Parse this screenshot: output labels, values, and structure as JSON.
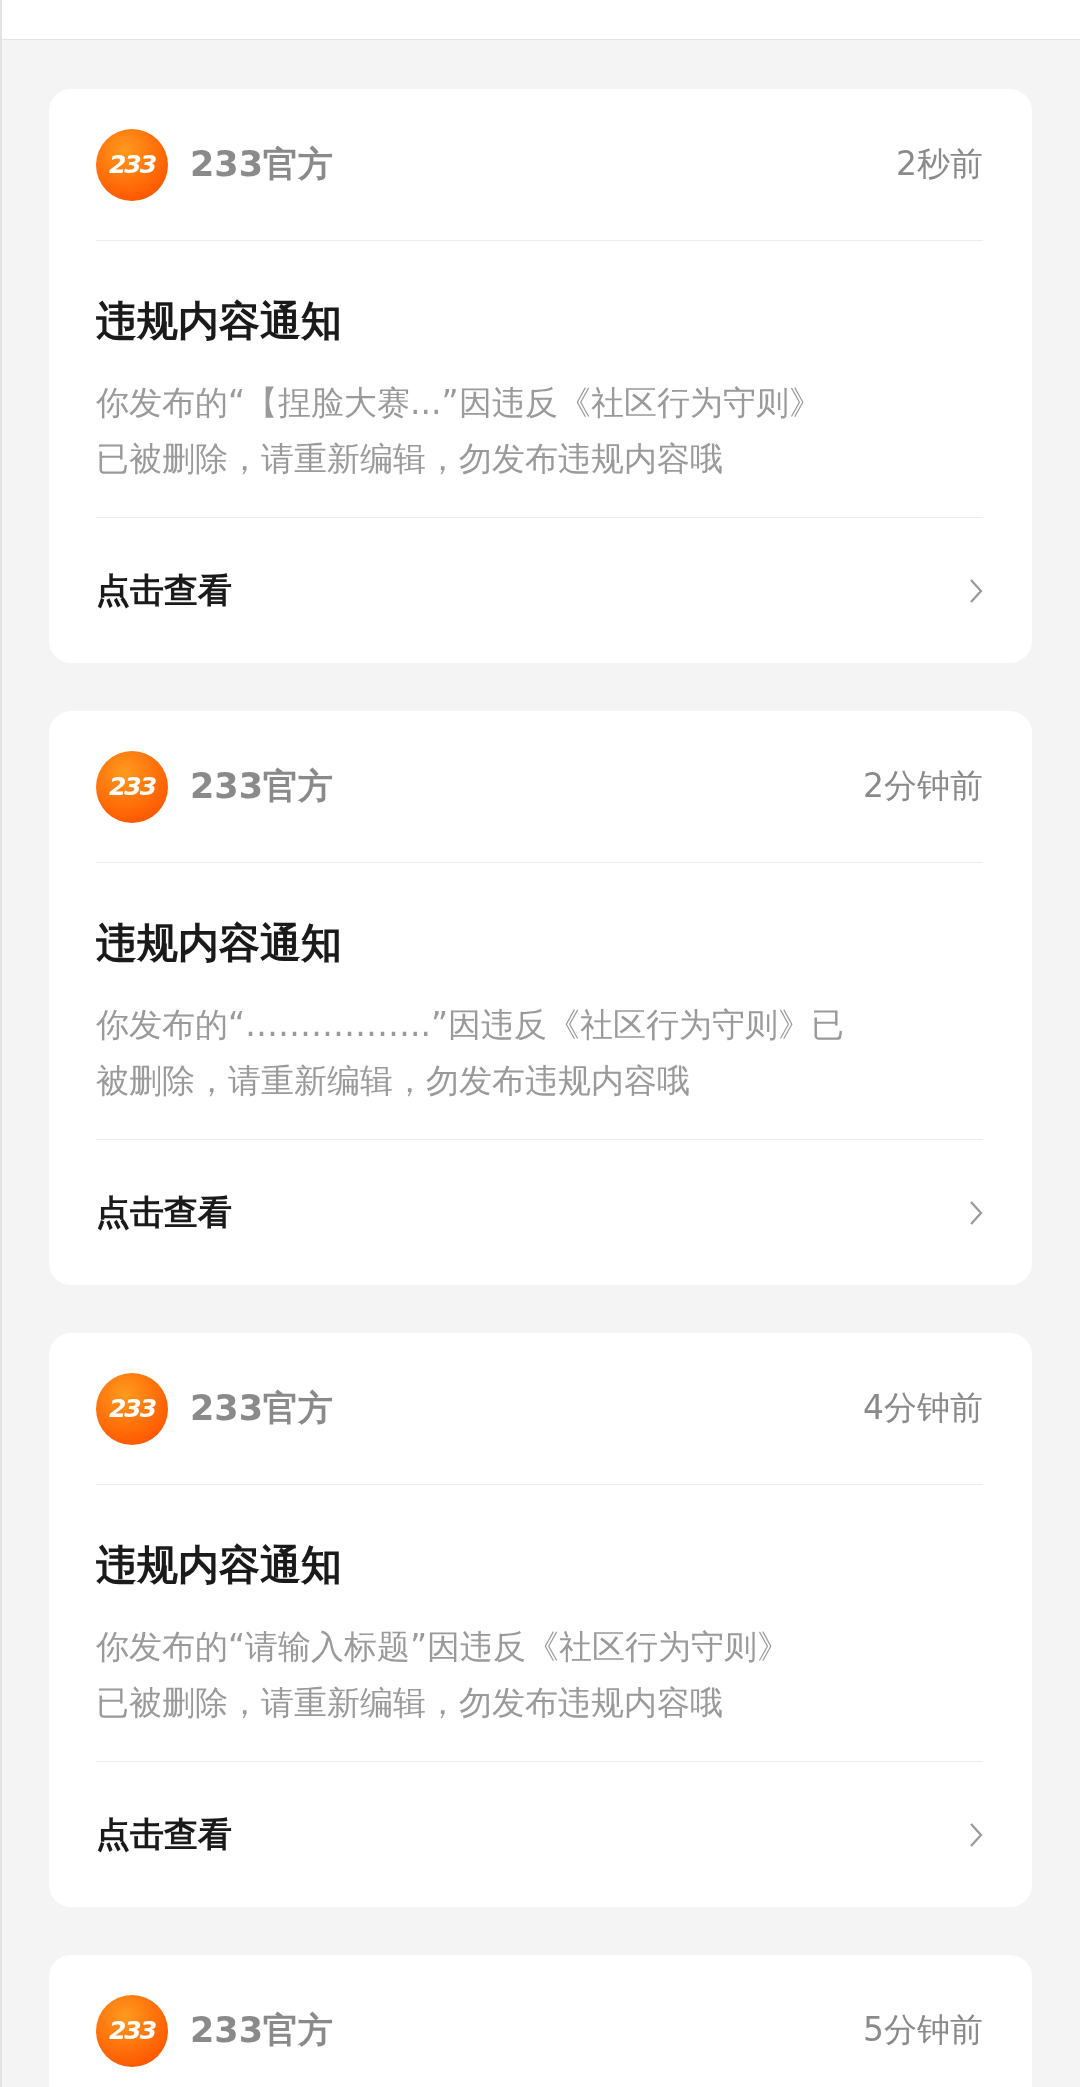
{
  "notifications": [
    {
      "logo_text": "233",
      "sender": "233官方",
      "time": "2秒前",
      "title": "违规内容通知",
      "body_lines": [
        "你发布的“【捏脸大赛...”因违反《社区行为守则》",
        "已被删除，请重新编辑，勿发布违规内容哦"
      ],
      "action": "点击查看"
    },
    {
      "logo_text": "233",
      "sender": "233官方",
      "time": "2分钟前",
      "title": "违规内容通知",
      "body_lines": [
        "你发布的“……………..”因违反《社区行为守则》已",
        "被删除，请重新编辑，勿发布违规内容哦"
      ],
      "action": "点击查看"
    },
    {
      "logo_text": "233",
      "sender": "233官方",
      "time": "4分钟前",
      "title": "违规内容通知",
      "body_lines": [
        "你发布的“请输入标题”因违反《社区行为守则》",
        "已被删除，请重新编辑，勿发布违规内容哦"
      ],
      "action": "点击查看"
    },
    {
      "logo_text": "233",
      "sender": "233官方",
      "time": "5分钟前"
    }
  ]
}
